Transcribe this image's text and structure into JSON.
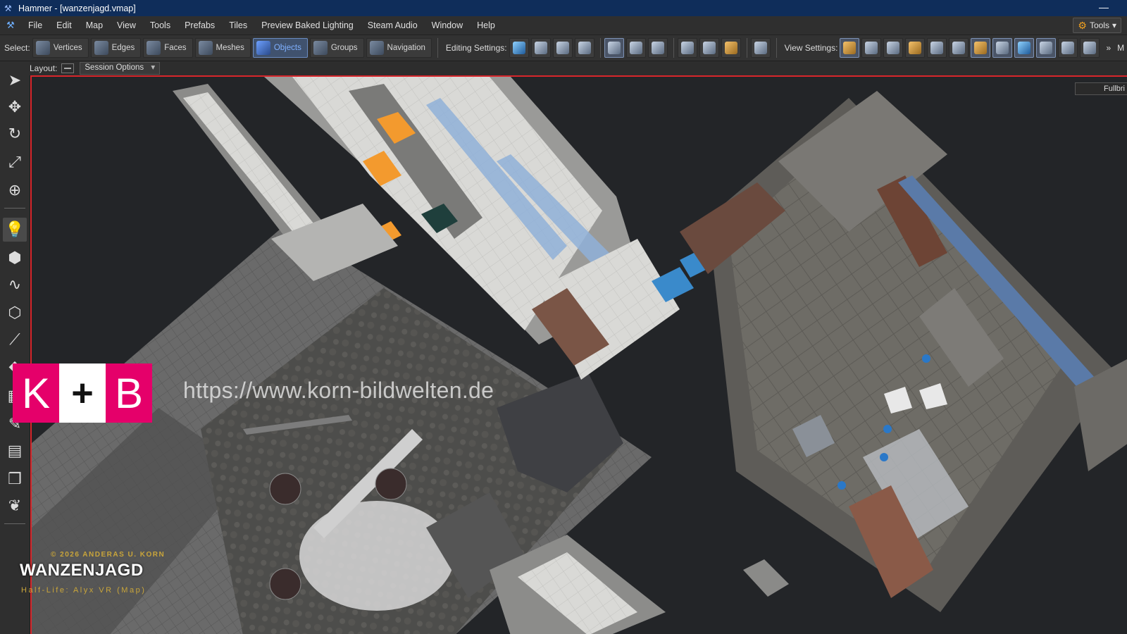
{
  "window": {
    "title": "Hammer - [wanzenjagd.vmap]"
  },
  "menu": {
    "items": [
      "File",
      "Edit",
      "Map",
      "View",
      "Tools",
      "Prefabs",
      "Tiles",
      "Preview Baked Lighting",
      "Steam Audio",
      "Window",
      "Help"
    ],
    "tools_button": "Tools"
  },
  "toolbar": {
    "select_label": "Select:",
    "select_modes": [
      {
        "label": "Vertices"
      },
      {
        "label": "Edges"
      },
      {
        "label": "Faces"
      },
      {
        "label": "Meshes"
      },
      {
        "label": "Objects",
        "active": true
      },
      {
        "label": "Groups"
      },
      {
        "label": "Navigation"
      }
    ],
    "editing_label": "Editing Settings:",
    "view_label": "View Settings:",
    "overflow": "»",
    "overflow_text": "M"
  },
  "layoutbar": {
    "label": "Layout:",
    "session_options": "Session Options"
  },
  "viewport": {
    "fullbright_label": "Fullbri"
  },
  "watermark": {
    "k": "K",
    "plus": "+",
    "b": "B",
    "url": "https://www.korn-bildwelten.de"
  },
  "credit": {
    "copyright": "© 2026 ANDERAS U. KORN",
    "title": "WANZENJAGD",
    "subtitle": "Half-Life: Alyx VR (Map)"
  },
  "colors": {
    "accent": "#e5006a",
    "selection_border": "#d8262b",
    "active_mode": "#7fb0ff"
  }
}
